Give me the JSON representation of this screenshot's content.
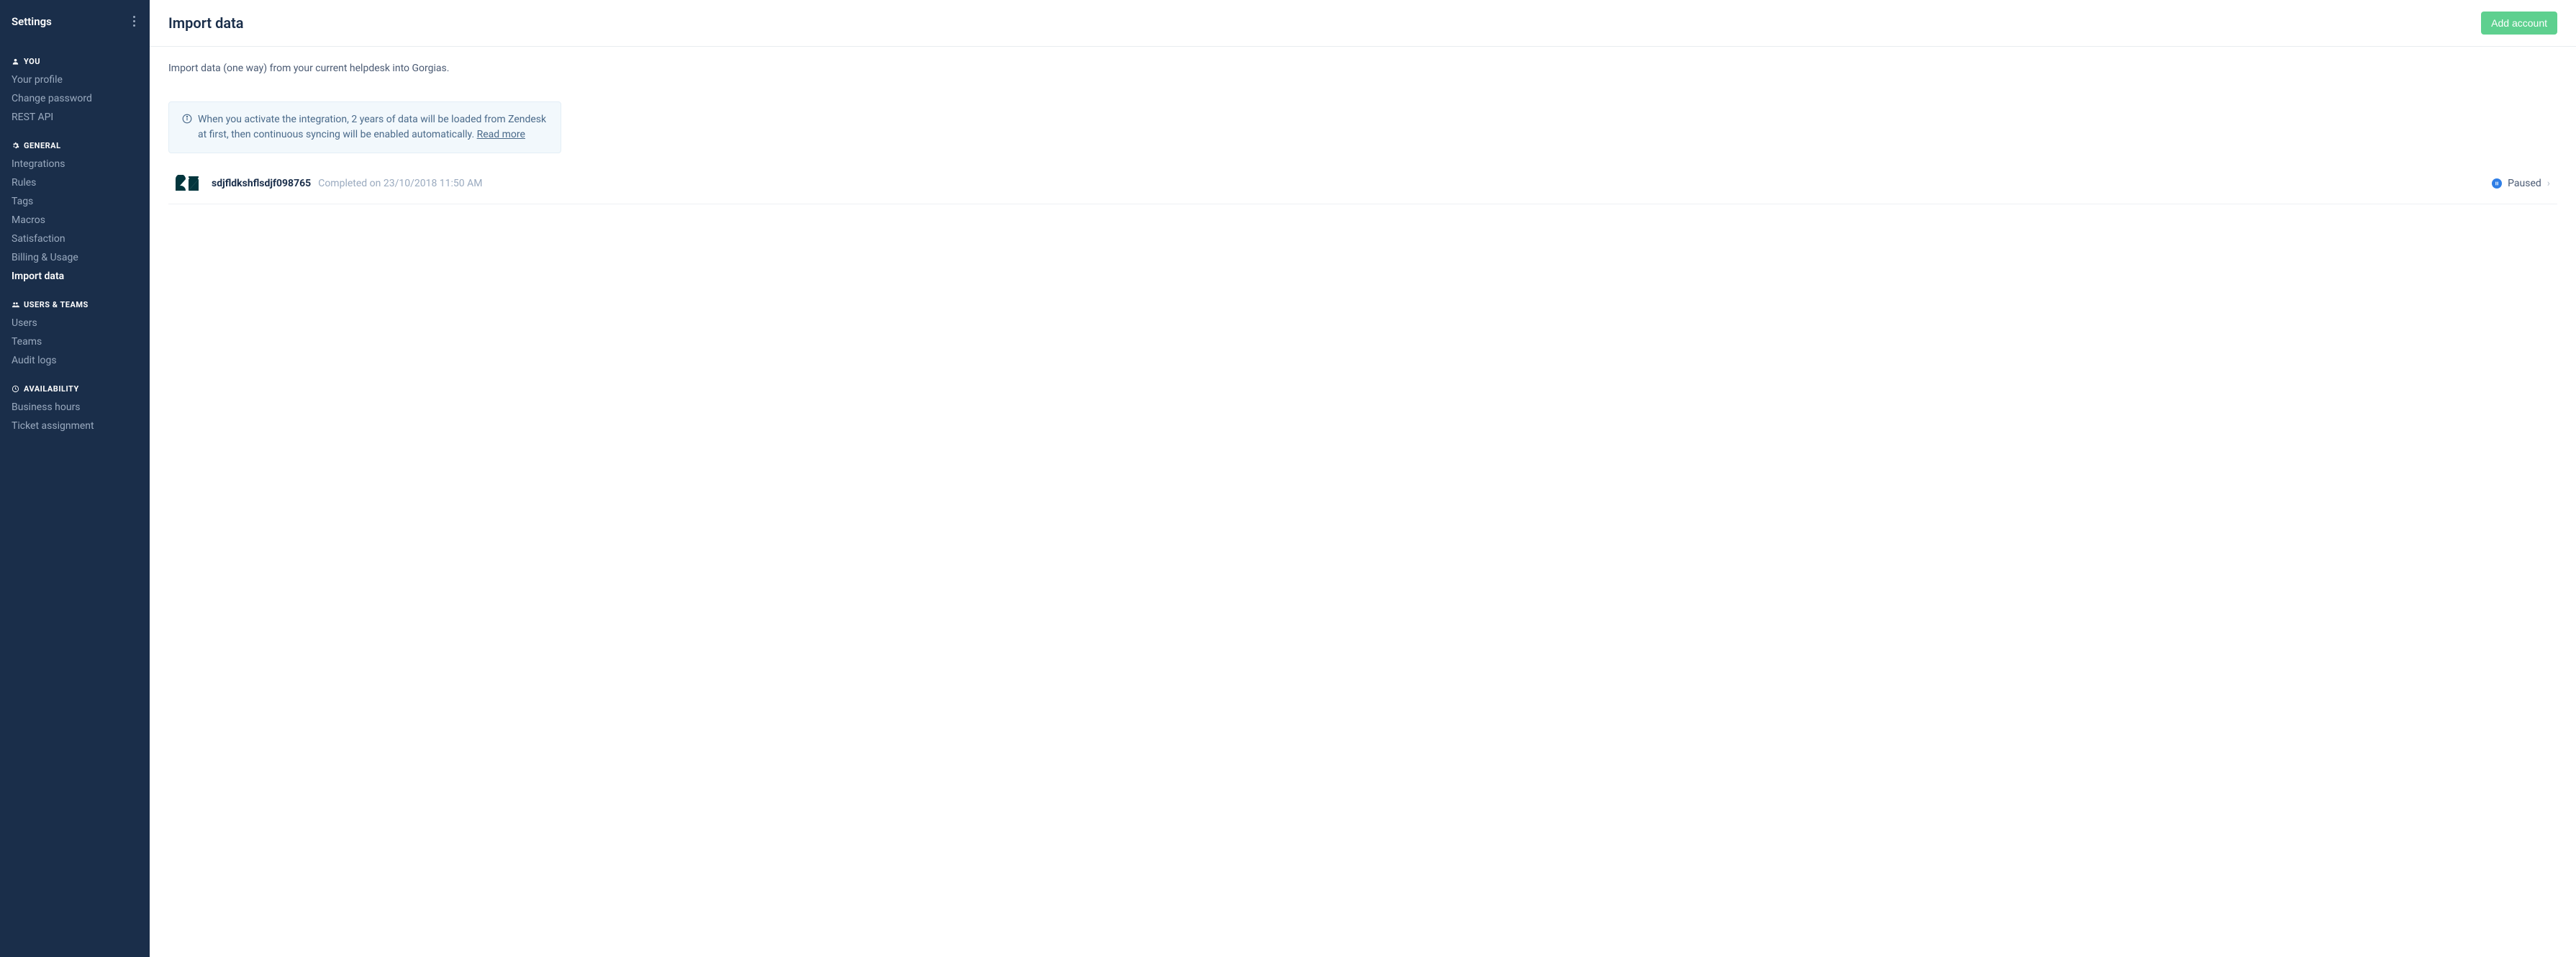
{
  "sidebar": {
    "title": "Settings",
    "sections": {
      "you": {
        "label": "YOU",
        "items": [
          {
            "label": "Your profile"
          },
          {
            "label": "Change password"
          },
          {
            "label": "REST API"
          }
        ]
      },
      "general": {
        "label": "GENERAL",
        "items": [
          {
            "label": "Integrations"
          },
          {
            "label": "Rules"
          },
          {
            "label": "Tags"
          },
          {
            "label": "Macros"
          },
          {
            "label": "Satisfaction"
          },
          {
            "label": "Billing & Usage"
          },
          {
            "label": "Import data",
            "active": true
          }
        ]
      },
      "users_teams": {
        "label": "USERS & TEAMS",
        "items": [
          {
            "label": "Users"
          },
          {
            "label": "Teams"
          },
          {
            "label": "Audit logs"
          }
        ]
      },
      "availability": {
        "label": "AVAILABILITY",
        "items": [
          {
            "label": "Business hours"
          },
          {
            "label": "Ticket assignment"
          }
        ]
      }
    }
  },
  "header": {
    "title": "Import data",
    "add_account_label": "Add account"
  },
  "content": {
    "description": "Import data (one way) from your current helpdesk into Gorgias.",
    "info_text": "When you activate the integration, 2 years of data will be loaded from Zendesk at first, then continuous syncing will be enabled automatically. ",
    "info_link": "Read more"
  },
  "integration": {
    "name": "sdjfldkshflsdjf098765",
    "meta": "Completed on 23/10/2018 11:50 AM",
    "status": "Paused"
  }
}
